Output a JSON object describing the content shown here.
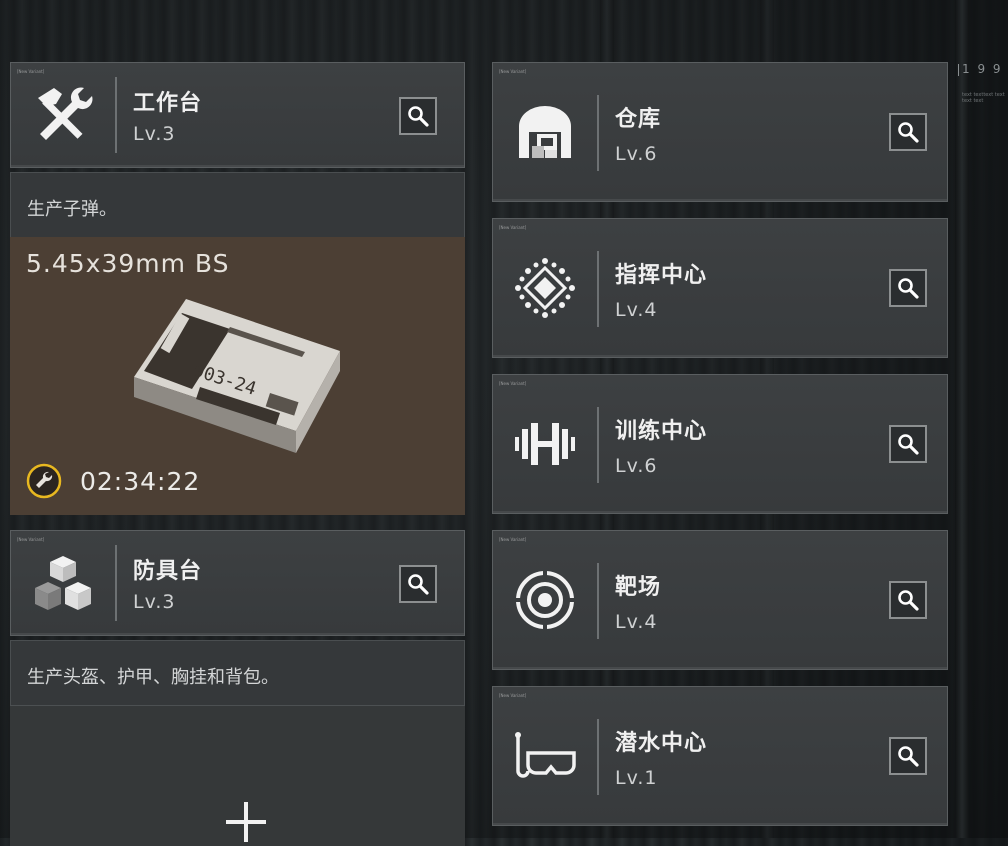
{
  "hud": {
    "code": "1 9 9",
    "fine_print": "text texttext text\ntext text"
  },
  "left": {
    "workbench": {
      "tag": "[New Variant]",
      "name": "工作台",
      "level": "Lv.3",
      "icon": "hammer-wrench-icon"
    },
    "workbench_desc": "生产子弹。",
    "production": {
      "item": "5.45x39mm BS",
      "timer": "02:34:22",
      "icon": "ammo-box-image"
    },
    "armor_bench": {
      "tag": "[New Variant]",
      "name": "防具台",
      "level": "Lv.3",
      "icon": "cubes-icon"
    },
    "armor_desc": "生产头盔、护甲、胸挂和背包。",
    "add_slot": {
      "label": "+"
    }
  },
  "right": [
    {
      "tag": "[New Variant]",
      "name": "仓库",
      "level": "Lv.6",
      "icon": "warehouse-icon"
    },
    {
      "tag": "[New Variant]",
      "name": "指挥中心",
      "level": "Lv.4",
      "icon": "command-diamond-icon"
    },
    {
      "tag": "[New Variant]",
      "name": "训练中心",
      "level": "Lv.6",
      "icon": "dumbbell-icon"
    },
    {
      "tag": "[New Variant]",
      "name": "靶场",
      "level": "Lv.4",
      "icon": "target-icon"
    },
    {
      "tag": "[New Variant]",
      "name": "潜水中心",
      "level": "Lv.1",
      "icon": "diving-mask-icon"
    }
  ],
  "colors": {
    "card_bg": "#3a3d3f",
    "production_bg": "#4c3f34",
    "timer_ring": "#e8b820"
  }
}
